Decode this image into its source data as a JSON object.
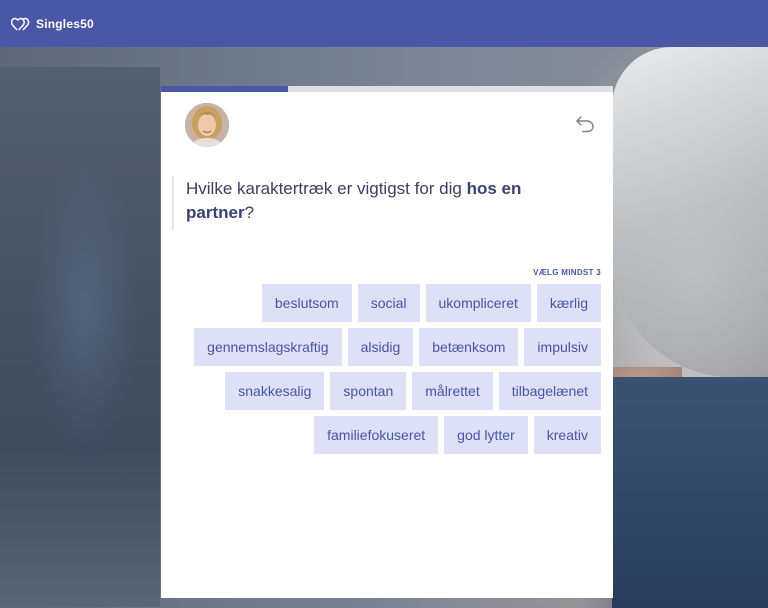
{
  "header": {
    "brand": "Singles50",
    "logo_icon": "double-heart-icon",
    "bg_color": "#4a56a6"
  },
  "progress": {
    "fraction": 0.28
  },
  "card": {
    "avatar_icon": "advisor-avatar",
    "back_icon": "back-arrow-icon",
    "question_pre": "Hvilke karaktertræk er vigtigst for dig ",
    "question_bold": "hos en partner",
    "question_post": "?",
    "hint": "VÆLG MINDST 3"
  },
  "traits": [
    "beslutsom",
    "social",
    "ukompliceret",
    "kærlig",
    "gennemslagskraftig",
    "alsidig",
    "betænksom",
    "impulsiv",
    "snakkesalig",
    "spontan",
    "målrettet",
    "tilbagelænet",
    "familiefokuseret",
    "god lytter",
    "kreativ"
  ],
  "colors": {
    "accent": "#4a56a6",
    "chip_bg": "#dde0f7",
    "chip_text": "#4a56a6"
  }
}
